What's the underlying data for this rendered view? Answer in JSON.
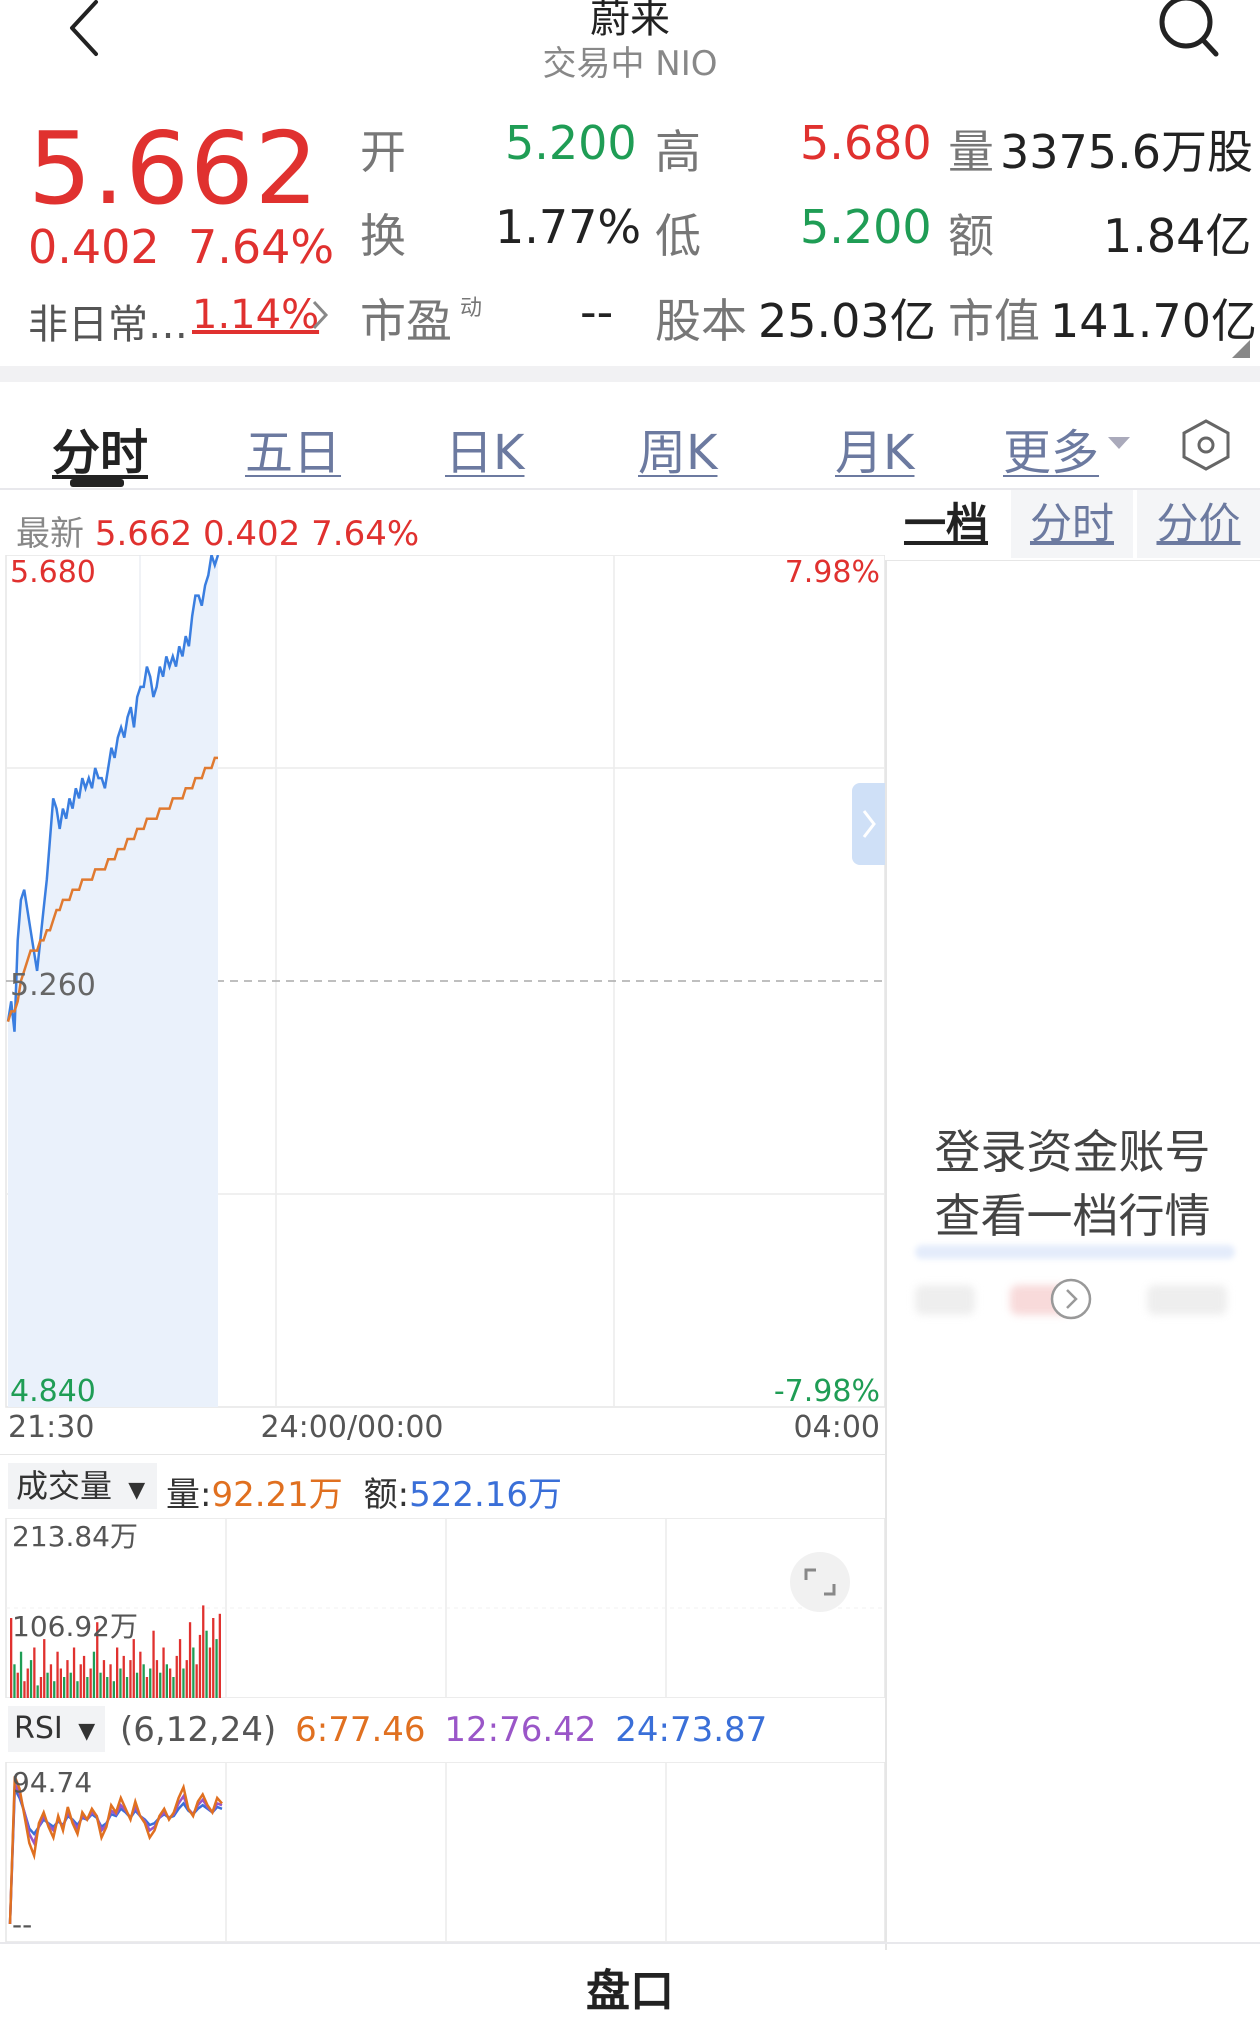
{
  "header": {
    "title": "蔚来",
    "subtitle": "交易中 NIO"
  },
  "quote": {
    "price": "5.662",
    "change": "0.402",
    "change_pct": "7.64%",
    "unusual_label": "非日常…",
    "unusual_value": "1.14%",
    "open_label": "开",
    "open_value": "5.200",
    "high_label": "高",
    "high_value": "5.680",
    "volume_label": "量",
    "volume_value": "3375.6万股",
    "turnover_label": "换",
    "turnover_value": "1.77%",
    "low_label": "低",
    "low_value": "5.200",
    "amount_label": "额",
    "amount_value": "1.84亿",
    "pe_label": "市盈",
    "pe_sup": "动",
    "pe_value": "--",
    "shares_label": "股本",
    "shares_value": "25.03亿",
    "mktcap_label": "市值",
    "mktcap_value": "141.70亿"
  },
  "tabs": [
    "分时",
    "五日",
    "日K",
    "周K",
    "月K",
    "更多"
  ],
  "latest": {
    "label": "最新",
    "price": "5.662",
    "change": "0.402",
    "pct": "7.64%"
  },
  "side_tabs": [
    "一档",
    "分时",
    "分价"
  ],
  "side_panel": {
    "line1": "登录资金账号",
    "line2": "查看一档行情"
  },
  "colors": {
    "up": "#e0312f",
    "down": "#1f9d55",
    "price_line": "#3a7ee0",
    "avg_line": "#e07a30",
    "rsi6": "#e07020",
    "rsi12": "#9a56c8",
    "rsi24": "#3a6fd8"
  },
  "chart_data": [
    {
      "type": "line",
      "title": "",
      "ylim": [
        4.84,
        5.68
      ],
      "y_ticks": [
        "5.680",
        "5.260",
        "4.840"
      ],
      "pct_ticks": [
        "7.98%",
        "-7.98%"
      ],
      "x_ticks": [
        "21:30",
        "24:00/00:00",
        "04:00"
      ],
      "prev_close": 5.26,
      "series": [
        {
          "values": [
            5.22,
            5.24,
            5.21,
            5.3,
            5.34,
            5.35,
            5.33,
            5.31,
            5.29,
            5.27,
            5.3,
            5.33,
            5.36,
            5.4,
            5.44,
            5.43,
            5.41,
            5.43,
            5.42,
            5.44,
            5.43,
            5.45,
            5.44,
            5.46,
            5.45,
            5.46,
            5.45,
            5.47,
            5.46,
            5.46,
            5.45,
            5.47,
            5.49,
            5.48,
            5.5,
            5.51,
            5.5,
            5.52,
            5.53,
            5.51,
            5.54,
            5.55,
            5.55,
            5.57,
            5.56,
            5.54,
            5.55,
            5.57,
            5.56,
            5.58,
            5.57,
            5.58,
            5.57,
            5.59,
            5.58,
            5.6,
            5.59,
            5.62,
            5.64,
            5.64,
            5.63,
            5.65,
            5.66,
            5.68,
            5.67,
            5.68
          ]
        },
        {
          "values": [
            5.22,
            5.23,
            5.23,
            5.24,
            5.26,
            5.27,
            5.28,
            5.29,
            5.29,
            5.29,
            5.3,
            5.3,
            5.31,
            5.31,
            5.32,
            5.33,
            5.33,
            5.34,
            5.34,
            5.34,
            5.35,
            5.35,
            5.35,
            5.36,
            5.36,
            5.36,
            5.36,
            5.37,
            5.37,
            5.37,
            5.37,
            5.38,
            5.38,
            5.38,
            5.39,
            5.39,
            5.39,
            5.4,
            5.4,
            5.4,
            5.41,
            5.41,
            5.41,
            5.42,
            5.42,
            5.42,
            5.42,
            5.43,
            5.43,
            5.43,
            5.43,
            5.44,
            5.44,
            5.44,
            5.44,
            5.45,
            5.45,
            5.45,
            5.46,
            5.46,
            5.46,
            5.47,
            5.47,
            5.47,
            5.48,
            5.48
          ]
        }
      ]
    },
    {
      "type": "bar",
      "title": "成交量",
      "label_vol": "量:",
      "vol_value": "92.21万",
      "label_amt": "额:",
      "amt_value": "522.16万",
      "y_ticks": [
        "213.84万",
        "106.92万"
      ],
      "ylim": [
        0,
        213.84
      ],
      "values": [
        95,
        40,
        30,
        55,
        20,
        35,
        45,
        60,
        15,
        25,
        70,
        30,
        40,
        20,
        55,
        35,
        25,
        45,
        30,
        60,
        20,
        40,
        50,
        25,
        35,
        55,
        90,
        30,
        45,
        25,
        40,
        20,
        60,
        35,
        50,
        25,
        45,
        70,
        30,
        55,
        40,
        25,
        35,
        80,
        45,
        30,
        60,
        40,
        35,
        25,
        50,
        70,
        35,
        45,
        90,
        60,
        40,
        75,
        110,
        80,
        60,
        95,
        70,
        100
      ],
      "directions": [
        1,
        0,
        1,
        0,
        1,
        1,
        0,
        1,
        0,
        1,
        1,
        0,
        1,
        0,
        1,
        1,
        0,
        1,
        0,
        1,
        0,
        1,
        1,
        0,
        1,
        0,
        1,
        0,
        1,
        0,
        1,
        0,
        1,
        0,
        1,
        0,
        1,
        1,
        0,
        1,
        0,
        1,
        0,
        1,
        1,
        0,
        1,
        0,
        1,
        0,
        1,
        1,
        0,
        1,
        1,
        0,
        1,
        1,
        1,
        0,
        1,
        1,
        0,
        1
      ]
    },
    {
      "type": "line",
      "title": "RSI",
      "params": "(6,12,24)",
      "rsi6_label": "6:77.46",
      "rsi12_label": "12:76.42",
      "rsi24_label": "24:73.87",
      "y_ticks": [
        "94.74",
        "--"
      ],
      "ylim": [
        0,
        100
      ],
      "series": [
        {
          "name": "6",
          "values": [
            10,
            92,
            85,
            70,
            55,
            48,
            66,
            72,
            64,
            58,
            70,
            62,
            75,
            66,
            60,
            72,
            68,
            74,
            70,
            58,
            64,
            76,
            72,
            80,
            74,
            68,
            78,
            70,
            66,
            58,
            62,
            70,
            74,
            68,
            72,
            80,
            86,
            74,
            70,
            78,
            82,
            76,
            72,
            80,
            77
          ]
        },
        {
          "name": "12",
          "values": [
            10,
            88,
            82,
            72,
            60,
            55,
            64,
            70,
            65,
            62,
            68,
            64,
            72,
            67,
            63,
            70,
            68,
            72,
            70,
            62,
            65,
            73,
            71,
            76,
            73,
            69,
            75,
            70,
            67,
            62,
            64,
            69,
            72,
            69,
            71,
            77,
            81,
            74,
            71,
            76,
            79,
            75,
            72,
            77,
            76
          ]
        },
        {
          "name": "24",
          "values": [
            10,
            85,
            80,
            72,
            63,
            60,
            64,
            68,
            66,
            64,
            67,
            65,
            70,
            68,
            65,
            69,
            68,
            71,
            69,
            64,
            66,
            71,
            70,
            74,
            72,
            69,
            73,
            70,
            68,
            65,
            66,
            69,
            71,
            69,
            70,
            74,
            77,
            73,
            71,
            74,
            76,
            74,
            72,
            75,
            74
          ]
        }
      ]
    }
  ],
  "footer": {
    "section_title": "盘口"
  }
}
